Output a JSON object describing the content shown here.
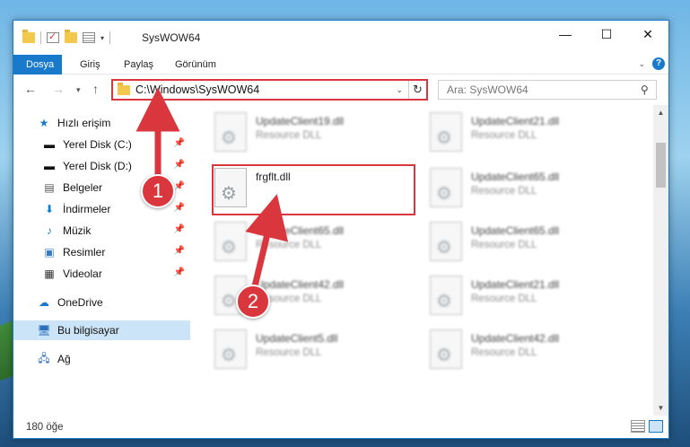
{
  "window": {
    "title": "SysWOW64"
  },
  "ribbon": {
    "tabs": [
      "Dosya",
      "Giriş",
      "Paylaş",
      "Görünüm"
    ],
    "help": "?"
  },
  "nav": {
    "address": "C:\\Windows\\SysWOW64",
    "search_placeholder": "Ara: SysWOW64"
  },
  "sidebar": {
    "items": [
      {
        "label": "Hızlı erişim",
        "icon": "star-icon"
      },
      {
        "label": "Yerel Disk (C:)",
        "icon": "drive-icon",
        "pinned": true
      },
      {
        "label": "Yerel Disk (D:)",
        "icon": "drive-icon",
        "pinned": true
      },
      {
        "label": "Belgeler",
        "icon": "documents-icon",
        "pinned": true
      },
      {
        "label": "İndirmeler",
        "icon": "downloads-icon",
        "pinned": true
      },
      {
        "label": "Müzik",
        "icon": "music-icon",
        "pinned": true
      },
      {
        "label": "Resimler",
        "icon": "pictures-icon",
        "pinned": true
      },
      {
        "label": "Videolar",
        "icon": "videos-icon",
        "pinned": true
      },
      {
        "label": "OneDrive",
        "icon": "cloud-icon"
      },
      {
        "label": "Bu bilgisayar",
        "icon": "computer-icon",
        "selected": true
      },
      {
        "label": "Ağ",
        "icon": "network-icon"
      }
    ]
  },
  "files": [
    {
      "name": "UpdateClient19.dll",
      "type": "Resource DLL"
    },
    {
      "name": "UpdateClient21.dll",
      "type": "Resource DLL"
    },
    {
      "name": "frgflt.dll",
      "type": ""
    },
    {
      "name": "UpdateClient65.dll",
      "type": "Resource DLL"
    },
    {
      "name": "UpdateClient65.dll",
      "type": "Resource DLL"
    },
    {
      "name": "UpdateClient65.dll",
      "type": "Resource DLL"
    },
    {
      "name": "UpdateClient42.dll",
      "type": "Resource DLL"
    },
    {
      "name": "UpdateClient21.dll",
      "type": "Resource DLL"
    },
    {
      "name": "UpdateClient5.dll",
      "type": "Resource DLL"
    },
    {
      "name": "UpdateClient42.dll",
      "type": "Resource DLL"
    }
  ],
  "status": {
    "count": "180 öğe"
  },
  "annotations": {
    "badge1": "1",
    "badge2": "2",
    "color": "#d9363e"
  }
}
